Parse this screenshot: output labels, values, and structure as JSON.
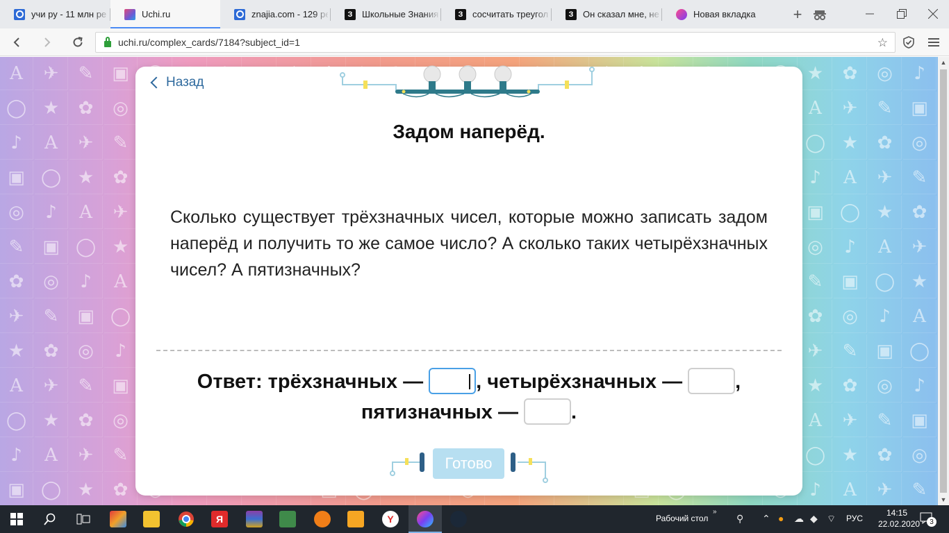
{
  "browser": {
    "tabs": [
      {
        "label": "учи ру - 11 млн ре",
        "icon": "search-icon",
        "active": false
      },
      {
        "label": "Uchi.ru",
        "icon": "uchi-icon",
        "active": true
      },
      {
        "label": "znajia.com - 129 ре",
        "icon": "search-icon",
        "active": false
      },
      {
        "label": "Школьные Знания.",
        "icon": "znanija-icon",
        "active": false
      },
      {
        "label": "сосчитать треуголь",
        "icon": "znanija-icon",
        "active": false
      },
      {
        "label": "Он сказал мне, не г",
        "icon": "znanija-icon",
        "active": false
      },
      {
        "label": "Новая вкладка",
        "icon": "newtab-icon",
        "active": false
      }
    ],
    "url": "uchi.ru/complex_cards/7184?subject_id=1"
  },
  "card": {
    "back_label": "Назад",
    "title": "Задом наперёд.",
    "question": "Сколько существует трёхзначных чисел, которые можно записать задом наперёд и получить то же самое число? А сколько таких четырёхзначных чисел? А пятизначных?",
    "answer": {
      "prefix": "Ответ: трёхзначных —",
      "mid": ", четырёхзначных —",
      "comma": ",",
      "line2": "пятизначных —",
      "end": ".",
      "values": [
        "",
        "",
        ""
      ]
    },
    "done_label": "Готово"
  },
  "taskbar": {
    "desktop_label": "Рабочий стол",
    "language": "РУС",
    "time": "14:15",
    "date": "22.02.2020",
    "notifications": "3"
  },
  "colors": {
    "accent": "#2f6a9e",
    "done_button": "#b7dff1",
    "taskbar": "#20262d"
  }
}
